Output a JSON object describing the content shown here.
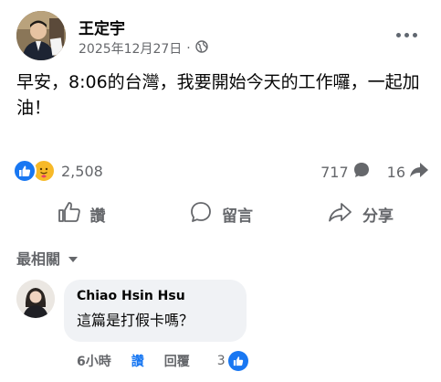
{
  "post": {
    "author": "王定宇",
    "date": "2025年12月27日",
    "separator": "·",
    "privacy_icon": "globe-icon",
    "text": "早安，8:06的台灣，我要開始今天的工作囉，一起加油！"
  },
  "stats": {
    "reaction_icons": [
      "like-icon",
      "care-icon"
    ],
    "reaction_count": "2,508",
    "comment_count": "717",
    "share_count": "16"
  },
  "actions": {
    "like_label": "讚",
    "comment_label": "留言",
    "share_label": "分享"
  },
  "sort": {
    "label": "最相關"
  },
  "comment": {
    "author": "Chiao Hsin Hsu",
    "text": "這篇是打假卡嗎？",
    "time": "6小時",
    "like_label": "讚",
    "reply_label": "回覆",
    "like_count": "3"
  },
  "colors": {
    "accent": "#1877f2",
    "secondary_text": "#65676b",
    "bubble_bg": "#f0f2f5",
    "care_yellow": "#f7b928"
  }
}
